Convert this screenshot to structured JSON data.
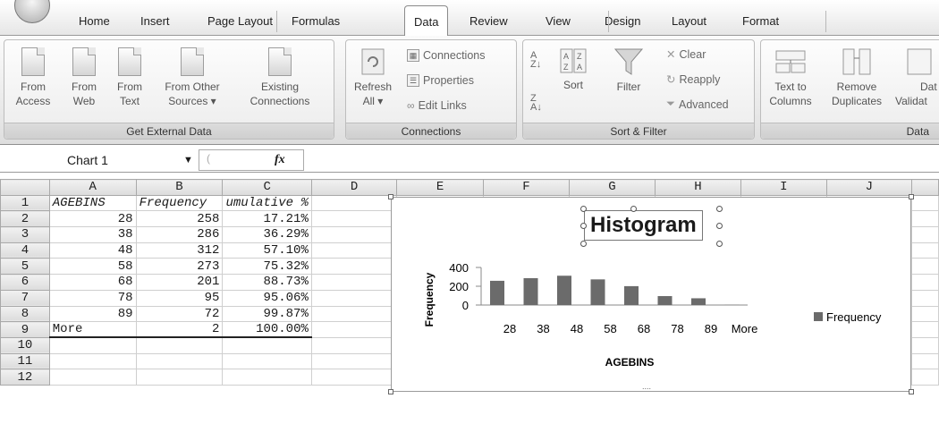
{
  "ribbon_tabs": [
    "Home",
    "Insert",
    "Page Layout",
    "Formulas",
    "Data",
    "Review",
    "View",
    "Design",
    "Layout",
    "Format"
  ],
  "active_tab": "Data",
  "groups": {
    "external": {
      "label": "Get External Data",
      "buttons": [
        {
          "l1": "From",
          "l2": "Access"
        },
        {
          "l1": "From",
          "l2": "Web"
        },
        {
          "l1": "From",
          "l2": "Text"
        },
        {
          "l1": "From Other",
          "l2": "Sources ▾"
        },
        {
          "l1": "Existing",
          "l2": "Connections"
        }
      ]
    },
    "connections": {
      "label": "Connections",
      "refresh_l1": "Refresh",
      "refresh_l2": "All ▾",
      "items": [
        "Connections",
        "Properties",
        "Edit Links"
      ]
    },
    "sort": {
      "label": "Sort & Filter",
      "sort": "Sort",
      "filter": "Filter",
      "clear": "Clear",
      "reapply": "Reapply",
      "advanced": "Advanced"
    },
    "tools": {
      "label": "Data",
      "text_to_l1": "Text to",
      "text_to_l2": "Columns",
      "remove_l1": "Remove",
      "remove_l2": "Duplicates",
      "valid_l1": "Dat",
      "valid_l2": "Validat"
    }
  },
  "formula_bar": {
    "name_box": "Chart 1",
    "fx": "fx"
  },
  "columns": [
    "A",
    "B",
    "C",
    "D",
    "E",
    "F",
    "G",
    "H",
    "I",
    "J"
  ],
  "rows": [
    {
      "n": "1",
      "a": "AGEBINS",
      "b": "Frequency",
      "c": "umulative %"
    },
    {
      "n": "2",
      "a": "28",
      "b": "258",
      "c": "17.21%"
    },
    {
      "n": "3",
      "a": "38",
      "b": "286",
      "c": "36.29%"
    },
    {
      "n": "4",
      "a": "48",
      "b": "312",
      "c": "57.10%"
    },
    {
      "n": "5",
      "a": "58",
      "b": "273",
      "c": "75.32%"
    },
    {
      "n": "6",
      "a": "68",
      "b": "201",
      "c": "88.73%"
    },
    {
      "n": "7",
      "a": "78",
      "b": "95",
      "c": "95.06%"
    },
    {
      "n": "8",
      "a": "89",
      "b": "72",
      "c": "99.87%"
    },
    {
      "n": "9",
      "a": "More",
      "b": "2",
      "c": "100.00%"
    },
    {
      "n": "10",
      "a": "",
      "b": "",
      "c": ""
    },
    {
      "n": "11",
      "a": "",
      "b": "",
      "c": ""
    },
    {
      "n": "12",
      "a": "",
      "b": "",
      "c": ""
    }
  ],
  "chart_data": {
    "type": "bar",
    "title": "Histogram",
    "xlabel": "AGEBINS",
    "ylabel": "Frequency",
    "categories": [
      "28",
      "38",
      "48",
      "58",
      "68",
      "78",
      "89",
      "More"
    ],
    "series": [
      {
        "name": "Frequency",
        "values": [
          258,
          286,
          312,
          273,
          201,
          95,
          72,
          2
        ]
      }
    ],
    "yticks": [
      "400",
      "200",
      "0"
    ],
    "ylim": [
      0,
      400
    ],
    "legend": "right",
    "bar_color": "#6b6b6b"
  }
}
